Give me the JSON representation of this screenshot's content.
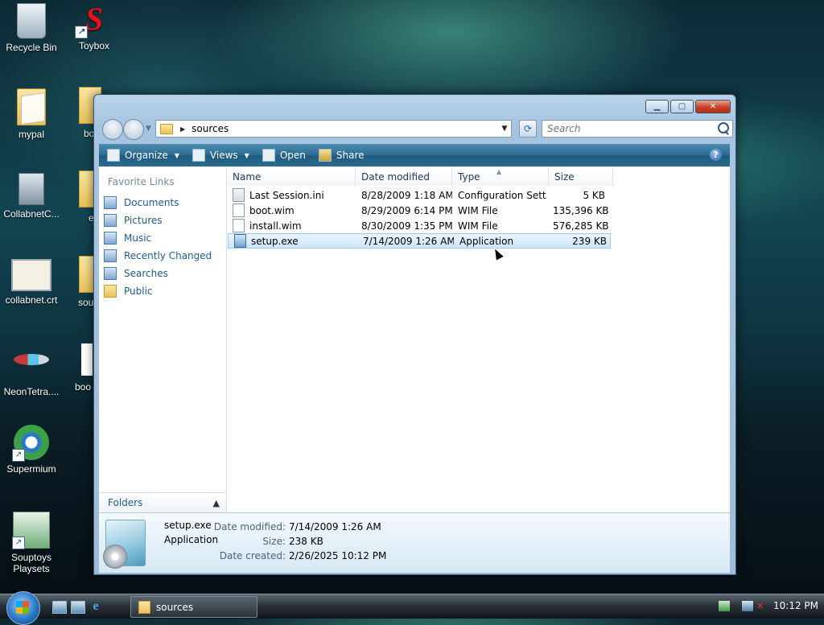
{
  "desktop": {
    "icons": [
      {
        "label": "Recycle Bin"
      },
      {
        "label": "Toybox"
      },
      {
        "label": "mypal"
      },
      {
        "label": "CollabnetC..."
      },
      {
        "label": "collabnet.crt"
      },
      {
        "label": "NeonTetra...."
      },
      {
        "label": "Supermium"
      },
      {
        "label": "Souptoys Playsets"
      }
    ],
    "partial_labels": [
      "bo",
      "e",
      "sou",
      "boo"
    ]
  },
  "window": {
    "address": {
      "path": "sources"
    },
    "search": {
      "placeholder": "Search"
    },
    "toolbar": {
      "organize": "Organize",
      "views": "Views",
      "open": "Open",
      "share": "Share",
      "help": "?"
    },
    "favorites": {
      "title": "Favorite Links",
      "items": [
        {
          "label": "Documents"
        },
        {
          "label": "Pictures"
        },
        {
          "label": "Music"
        },
        {
          "label": "Recently Changed"
        },
        {
          "label": "Searches"
        },
        {
          "label": "Public"
        }
      ],
      "folders_label": "Folders"
    },
    "columns": {
      "name": "Name",
      "date": "Date modified",
      "type": "Type",
      "size": "Size"
    },
    "files": [
      {
        "name": "Last Session.ini",
        "date": "8/28/2009 1:18 AM",
        "type": "Configuration Sett...",
        "size": "5 KB",
        "icon": "config-file-icon"
      },
      {
        "name": "boot.wim",
        "date": "8/29/2009 6:14 PM",
        "type": "WIM File",
        "size": "135,396 KB",
        "icon": "file-icon"
      },
      {
        "name": "install.wim",
        "date": "8/30/2009 1:35 PM",
        "type": "WIM File",
        "size": "576,285 KB",
        "icon": "file-icon"
      },
      {
        "name": "setup.exe",
        "date": "7/14/2009 1:26 AM",
        "type": "Application",
        "size": "239 KB",
        "icon": "application-icon",
        "selected": true
      }
    ],
    "details": {
      "name": "setup.exe",
      "type": "Application",
      "modified_label": "Date modified:",
      "modified_value": "7/14/2009 1:26 AM",
      "size_label": "Size:",
      "size_value": "238 KB",
      "created_label": "Date created:",
      "created_value": "2/26/2025 10:12 PM"
    }
  },
  "taskbar": {
    "task": "sources",
    "clock": "10:12 PM"
  }
}
